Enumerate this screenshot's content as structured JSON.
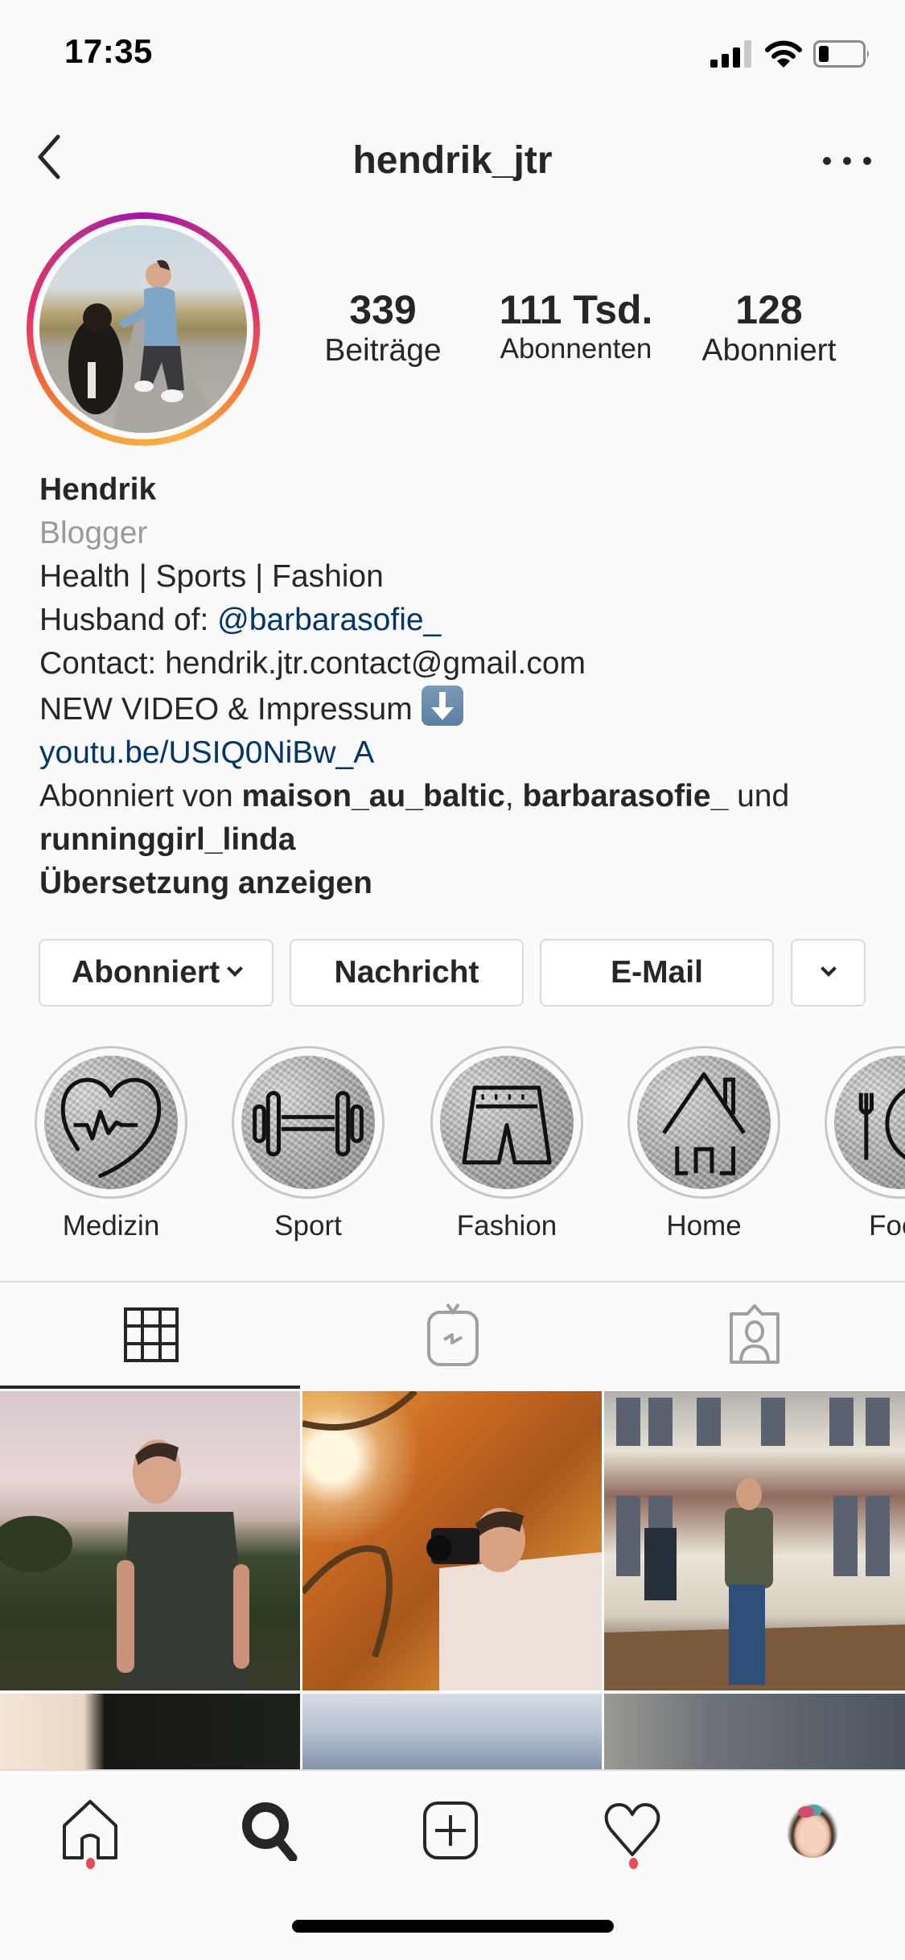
{
  "status_bar": {
    "time": "17:35",
    "icons": [
      "cellular-signal-icon",
      "wifi-icon",
      "battery-low-icon"
    ]
  },
  "nav": {
    "back_icon": "chevron-left-icon",
    "title": "hendrik_jtr",
    "more_icon": "more-horizontal-icon"
  },
  "profile": {
    "avatar_icon": "profile-photo-man-with-dog",
    "has_story_ring": true,
    "stats": [
      {
        "value": "339",
        "label": "Beiträge"
      },
      {
        "value": "111 Tsd.",
        "label": "Abonnenten"
      },
      {
        "value": "128",
        "label": "Abonniert"
      }
    ]
  },
  "bio": {
    "name": "Hendrik",
    "category": "Blogger",
    "line1": "Health | Sports | Fashion",
    "line2_prefix": "Husband of: ",
    "line2_mention": "@barbarasofie_",
    "line3": "Contact: hendrik.jtr.contact@gmail.com",
    "line4": "NEW VIDEO & Impressum",
    "line4_emoji": "down-arrow-emoji",
    "link": "youtu.be/USIQ0NiBw_A",
    "followed_by_prefix": "Abonniert von ",
    "followed_by_1": "maison_au_baltic",
    "followed_by_sep": ", ",
    "followed_by_2": "barbarasofie_",
    "followed_by_and": " und",
    "followed_by_3": "runninggirl_linda",
    "translate": "Übersetzung anzeigen"
  },
  "actions": {
    "following": "Abonniert",
    "message": "Nachricht",
    "email": "E-Mail",
    "suggestions_icon": "chevron-down-icon"
  },
  "highlights": [
    {
      "label": "Medizin",
      "icon": "heart-pulse-icon"
    },
    {
      "label": "Sport",
      "icon": "dumbbell-icon"
    },
    {
      "label": "Fashion",
      "icon": "shorts-icon"
    },
    {
      "label": "Home",
      "icon": "house-icon"
    },
    {
      "label": "Food",
      "icon": "fork-plate-icon"
    }
  ],
  "profile_tabs": [
    {
      "name": "posts-grid",
      "icon": "grid-icon",
      "active": true
    },
    {
      "name": "igtv",
      "icon": "igtv-icon",
      "active": false
    },
    {
      "name": "tagged",
      "icon": "tagged-person-icon",
      "active": false
    }
  ],
  "grid": [
    {
      "description": "man in dark t-shirt at sunset field"
    },
    {
      "description": "man taking photo with camera in autumn tree"
    },
    {
      "description": "man in green jacket in front of historic building"
    },
    {
      "description": "tree silhouette against bright sky"
    },
    {
      "description": "cloudy sky"
    },
    {
      "description": "grey overcast sky"
    }
  ],
  "bottom_nav": [
    {
      "name": "home",
      "icon": "home-icon",
      "notification_dot": true
    },
    {
      "name": "search",
      "icon": "search-icon",
      "notification_dot": false,
      "active": true
    },
    {
      "name": "new-post",
      "icon": "plus-square-icon",
      "notification_dot": false
    },
    {
      "name": "activity",
      "icon": "heart-icon",
      "notification_dot": true
    },
    {
      "name": "profile",
      "icon": "user-avatar",
      "notification_dot": false
    }
  ],
  "colors": {
    "background": "#fafafa",
    "text": "#262626",
    "link": "#003569",
    "secondary_text": "#9a9a9a",
    "border": "#dbdbdb",
    "notification": "#ed4956"
  }
}
